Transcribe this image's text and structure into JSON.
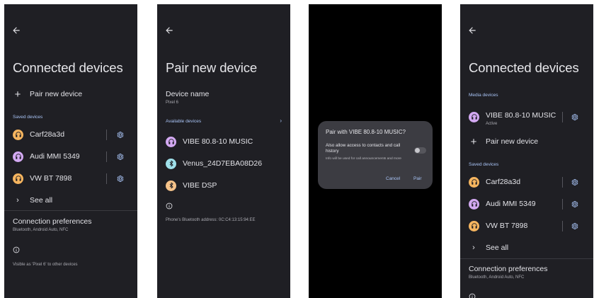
{
  "screen1": {
    "title": "Connected devices",
    "pair_new_label": "Pair new device",
    "saved_section": "Saved devices",
    "devices": [
      {
        "name": "Carf28a3d",
        "icon": "headphones-icon",
        "color": "#f6b55f"
      },
      {
        "name": "Audi MMI 5349",
        "icon": "headphones-icon",
        "color": "#d3a9f2"
      },
      {
        "name": "VW BT 7898",
        "icon": "headphones-icon",
        "color": "#f6b55f"
      }
    ],
    "see_all": "See all",
    "prefs_title": "Connection preferences",
    "prefs_sub": "Bluetooth, Android Auto, NFC",
    "visible_text": "Visible as 'Pixel 6' to other devices"
  },
  "screen2": {
    "title": "Pair new device",
    "device_name_label": "Device name",
    "device_name_value": "Pixel 6",
    "available_section": "Available devices",
    "devices": [
      {
        "name": "VIBE 80.8-10 MUSIC",
        "icon": "headphones-icon",
        "color": "#d3a9f2"
      },
      {
        "name": "Venus_24D7EBA08D26",
        "icon": "bluetooth-icon",
        "color": "#9fe0ea"
      },
      {
        "name": "VIBE DSP",
        "icon": "bluetooth-icon",
        "color": "#f6c38a"
      }
    ],
    "address_text": "Phone's Bluetooth address: 0C:C4:13:15:94:EE"
  },
  "screen3": {
    "dialog_title": "Pair with VIBE 80.8-10 MUSIC?",
    "dialog_body": "Also allow access to contacts and call history",
    "dialog_note": "Info will be used for call announcements and more",
    "toggle_on": false,
    "cancel_label": "Cancel",
    "pair_label": "Pair"
  },
  "screen4": {
    "title": "Connected devices",
    "media_section": "Media devices",
    "media_device": {
      "name": "VIBE 80.8-10 MUSIC",
      "status": "Active",
      "icon": "headphones-icon",
      "color": "#d3a9f2"
    },
    "pair_new_label": "Pair new device",
    "saved_section": "Saved devices",
    "devices": [
      {
        "name": "Carf28a3d",
        "icon": "headphones-icon",
        "color": "#f6b55f"
      },
      {
        "name": "Audi MMI 5349",
        "icon": "headphones-icon",
        "color": "#d3a9f2"
      },
      {
        "name": "VW BT 7898",
        "icon": "headphones-icon",
        "color": "#f6b55f"
      }
    ],
    "see_all": "See all",
    "prefs_title": "Connection preferences",
    "prefs_sub": "Bluetooth, Android Auto, NFC"
  },
  "colors": {
    "background": "#1f1f24",
    "accent": "#a8c3f5",
    "dialog": "#3c3c42"
  }
}
